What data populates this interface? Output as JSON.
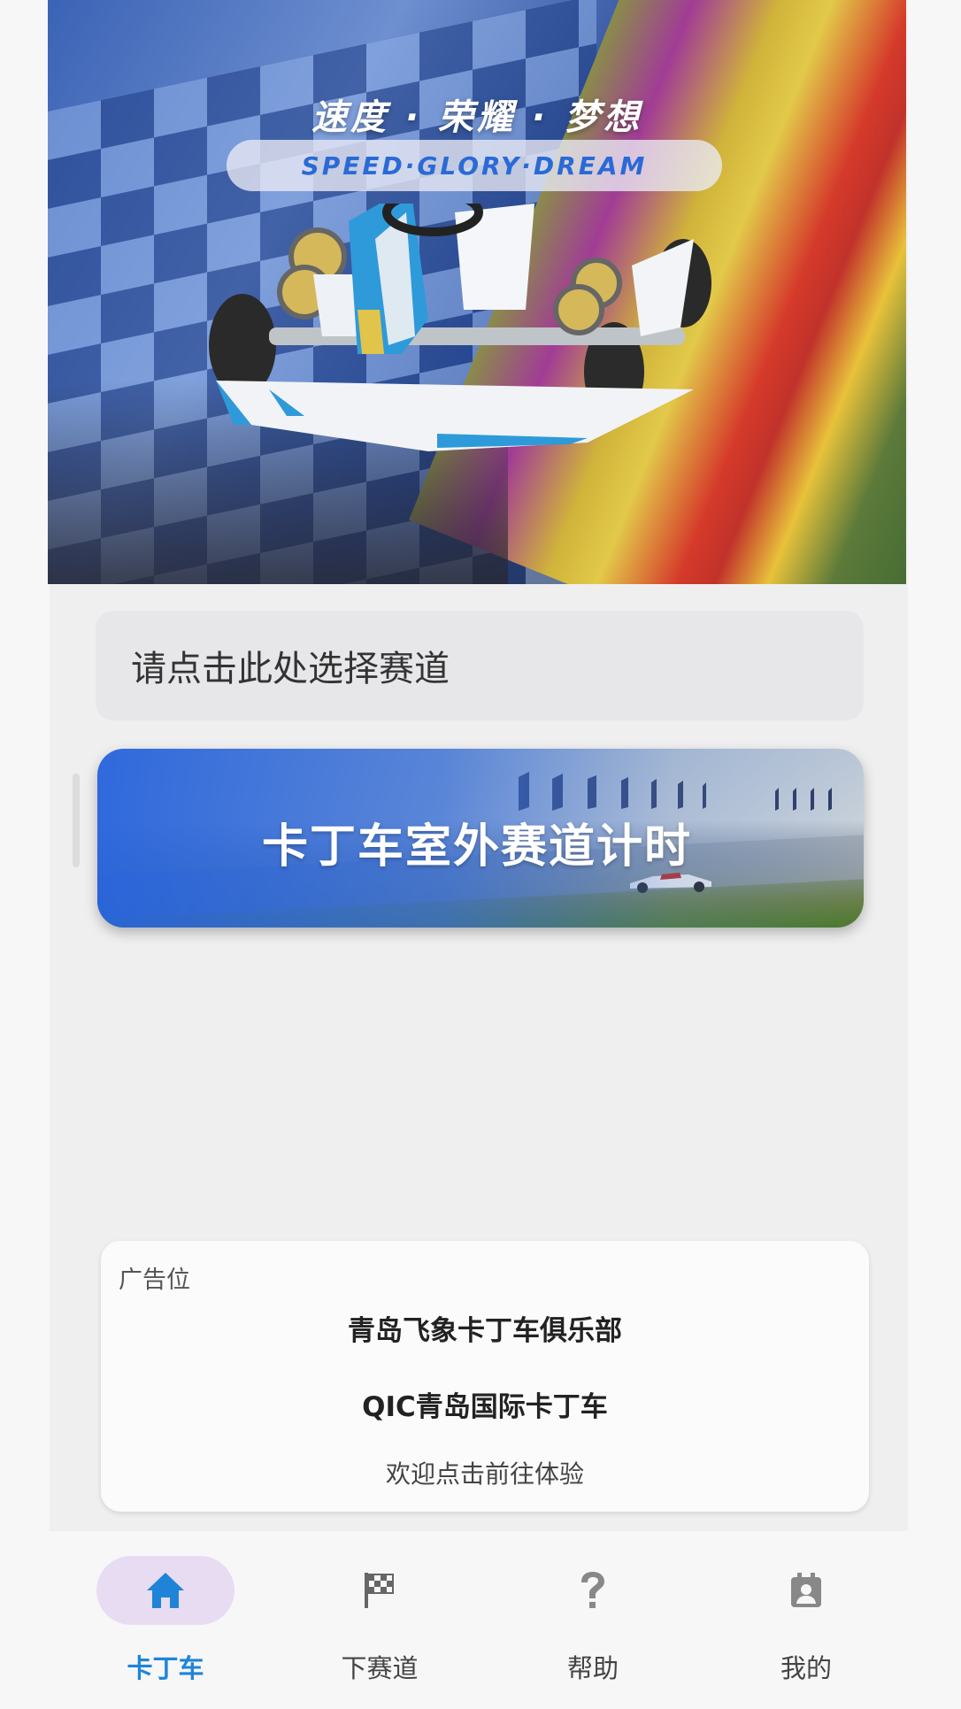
{
  "hero": {
    "title": "速度 · 荣耀 · 梦想",
    "subtitle": "SPEED·GLORY·DREAM"
  },
  "track_select": {
    "placeholder": "请点击此处选择赛道"
  },
  "timing_card": {
    "label": "卡丁车室外赛道计时"
  },
  "ad": {
    "tag": "广告位",
    "line1": "青岛飞象卡丁车俱乐部",
    "line2": "QIC青岛国际卡丁车",
    "line3": "欢迎点击前往体验"
  },
  "nav": {
    "items": [
      {
        "label": "卡丁车",
        "icon": "home-icon",
        "active": true
      },
      {
        "label": "下赛道",
        "icon": "checkered-flag-icon",
        "active": false
      },
      {
        "label": "帮助",
        "icon": "question-icon",
        "active": false
      },
      {
        "label": "我的",
        "icon": "profile-calendar-icon",
        "active": false
      }
    ]
  },
  "colors": {
    "accent_blue": "#1f84d8",
    "active_pill": "#e8dcf3",
    "card_blue": "#2864dc"
  }
}
